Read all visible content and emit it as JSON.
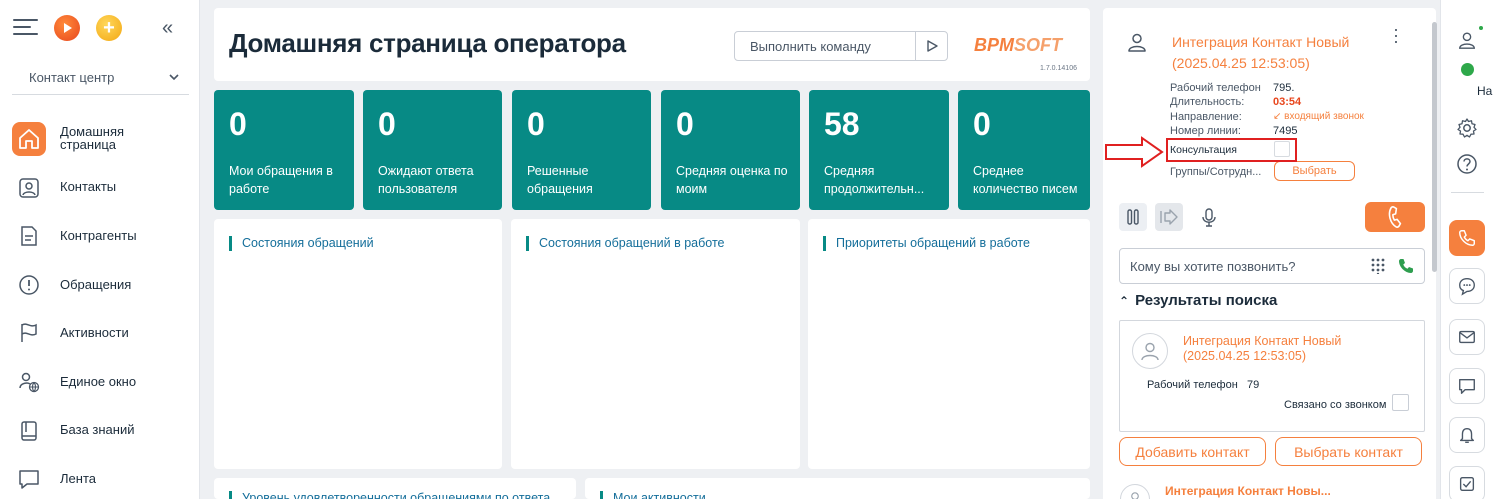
{
  "sidebar": {
    "workplace": "Контакт центр",
    "items": [
      {
        "label": "Домашняя страница",
        "icon": "home-icon"
      },
      {
        "label": "Контакты",
        "icon": "contact-icon"
      },
      {
        "label": "Контрагенты",
        "icon": "document-icon"
      },
      {
        "label": "Обращения",
        "icon": "alert-icon"
      },
      {
        "label": "Активности",
        "icon": "flag-icon"
      },
      {
        "label": "Единое окно",
        "icon": "user-globe-icon"
      },
      {
        "label": "База знаний",
        "icon": "book-icon"
      },
      {
        "label": "Лента",
        "icon": "chat-icon"
      }
    ]
  },
  "header": {
    "title": "Домашняя страница оператора",
    "command_placeholder": "Выполнить команду",
    "logo_bpm": "BPM",
    "logo_soft": "SOFT",
    "version": "1.7.0.14106"
  },
  "tiles": [
    {
      "value": "0",
      "caption": "Мои обращения в работе"
    },
    {
      "value": "0",
      "caption": "Ожидают ответа пользователя"
    },
    {
      "value": "0",
      "caption": "Решенные обращения"
    },
    {
      "value": "0",
      "caption": "Средняя оценка по моим"
    },
    {
      "value": "58",
      "caption": "Средняя продолжительн..."
    },
    {
      "value": "0",
      "caption": "Среднее количество писем"
    }
  ],
  "panels": {
    "p1": "Состояния обращений",
    "p2": "Состояния обращений в работе",
    "p3": "Приоритеты обращений в работе",
    "p4": "Уровень удовлетворенности обращениями по ответа...",
    "p5": "Мои активности"
  },
  "call": {
    "contact_name": "Интеграция Контакт Новый",
    "contact_date": "(2025.04.25 12:53:05)",
    "work_phone_label": "Рабочий телефон",
    "work_phone_value": "795.",
    "duration_label": "Длительность:",
    "duration_value": "03:54",
    "direction_label": "Направление:",
    "direction_value": "↙ входящий звонок",
    "line_label": "Номер линии:",
    "line_value": "7495",
    "consult_label": "Консультация",
    "groups_label": "Группы/Сотрудн...",
    "choose_label": "Выбрать",
    "dial_placeholder": "Кому вы хотите позвонить?",
    "results_header": "Результаты поиска",
    "result": {
      "name": "Интеграция Контакт Новый",
      "date": "(2025.04.25 12:53:05)",
      "phone_label": "Рабочий телефон",
      "phone_value": "79",
      "linked_label": "Связано со звонком"
    },
    "add_contact": "Добавить контакт",
    "select_contact": "Выбрать контакт",
    "next_result": "Интеграция Контакт Новы..."
  },
  "rightbar": {
    "status_text": "На"
  },
  "colors": {
    "accent": "#f5803e",
    "tile": "#078a85",
    "link": "#146e9a",
    "highlight": "#e02020"
  }
}
